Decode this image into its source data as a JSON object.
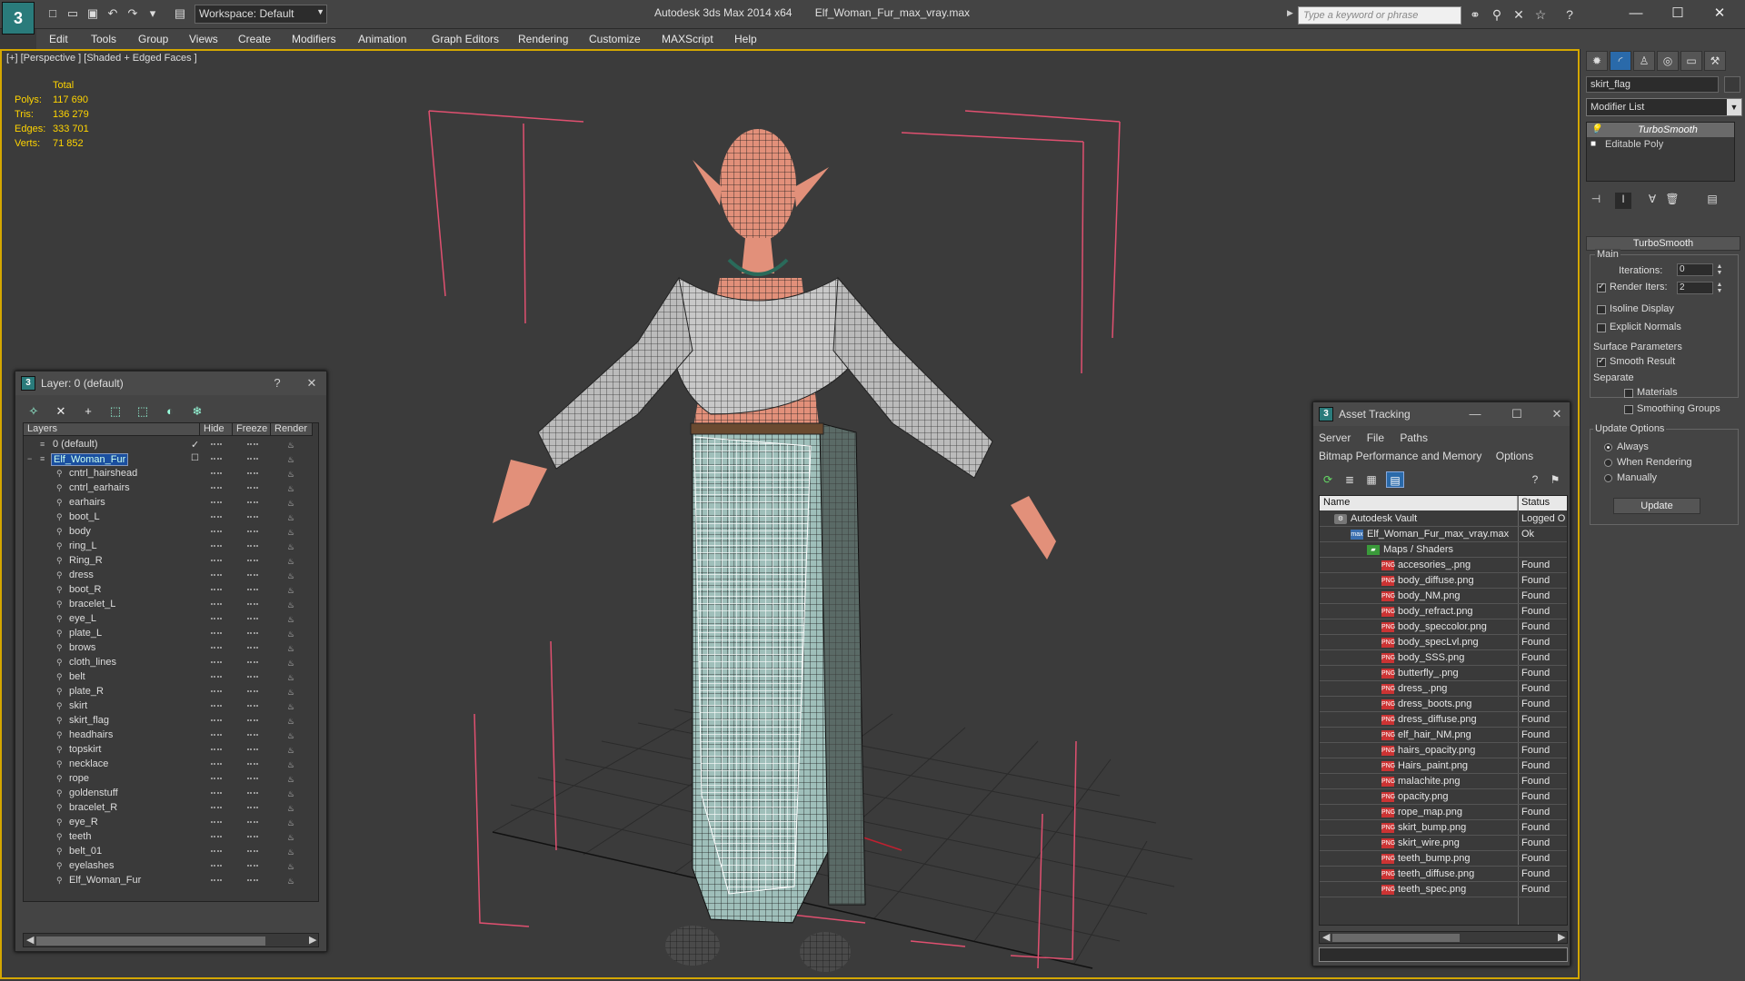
{
  "app": {
    "logo": "3",
    "workspace": "Workspace: Default",
    "title_app": "Autodesk 3ds Max  2014 x64",
    "title_file": "Elf_Woman_Fur_max_vray.max",
    "search_placeholder": "Type a keyword or phrase"
  },
  "menu": [
    "Edit",
    "Tools",
    "Group",
    "Views",
    "Create",
    "Modifiers",
    "Animation",
    "Graph Editors",
    "Rendering",
    "Customize",
    "MAXScript",
    "Help"
  ],
  "viewport": {
    "label": "[+] [Perspective ] [Shaded + Edged Faces ]",
    "stats": {
      "header": "Total",
      "polys_label": "Polys:",
      "polys": "117 690",
      "tris_label": "Tris:",
      "tris": "136 279",
      "edges_label": "Edges:",
      "edges": "333 701",
      "verts_label": "Verts:",
      "verts": "71 852"
    },
    "colors": {
      "border": "#d4a700",
      "stats": "#ffd400",
      "bbox": "#e05070",
      "grid": "#2c2c2c"
    }
  },
  "command_panel": {
    "object_name": "skirt_flag",
    "modifier_list": "Modifier List",
    "stack": [
      "TurboSmooth",
      "Editable Poly"
    ],
    "turbosmooth": {
      "title": "TurboSmooth",
      "main": "Main",
      "iterations_label": "Iterations:",
      "iterations": "0",
      "render_iters_label": "Render Iters:",
      "render_iters": "2",
      "isoline": "Isoline Display",
      "explicit": "Explicit Normals",
      "surface": "Surface Parameters",
      "smooth_result": "Smooth Result",
      "separate": "Separate",
      "materials": "Materials",
      "smoothing_groups": "Smoothing Groups",
      "update_options": "Update Options",
      "always": "Always",
      "when_rendering": "When Rendering",
      "manually": "Manually",
      "update": "Update"
    }
  },
  "layer_dialog": {
    "title": "Layer: 0 (default)",
    "help": "?",
    "close": "✕",
    "columns": {
      "layers": "Layers",
      "hide": "Hide",
      "freeze": "Freeze",
      "render": "Render"
    },
    "rows": [
      "0 (default)",
      "Elf_Woman_Fur",
      "cntrl_hairshead",
      "cntrl_earhairs",
      "earhairs",
      "boot_L",
      "body",
      "ring_L",
      "Ring_R",
      "dress",
      "boot_R",
      "bracelet_L",
      "eye_L",
      "plate_L",
      "brows",
      "cloth_lines",
      "belt",
      "plate_R",
      "skirt",
      "skirt_flag",
      "headhairs",
      "topskirt",
      "necklace",
      "rope",
      "goldenstuff",
      "bracelet_R",
      "eye_R",
      "teeth",
      "belt_01",
      "eyelashes",
      "Elf_Woman_Fur"
    ]
  },
  "asset_dialog": {
    "title": "Asset Tracking",
    "menu1": [
      "Server",
      "File",
      "Paths"
    ],
    "menu2": [
      "Bitmap Performance and Memory",
      "Options"
    ],
    "columns": {
      "name": "Name",
      "status": "Status"
    },
    "vault": {
      "name": "Autodesk Vault",
      "status": "Logged O"
    },
    "file": {
      "name": "Elf_Woman_Fur_max_vray.max",
      "status": "Ok"
    },
    "folder": {
      "name": "Maps / Shaders",
      "status": ""
    },
    "maps": [
      "accesories_.png",
      "body_diffuse.png",
      "body_NM.png",
      "body_refract.png",
      "body_speccolor.png",
      "body_specLvl.png",
      "body_SSS.png",
      "butterfly_.png",
      "dress_.png",
      "dress_boots.png",
      "dress_diffuse.png",
      "elf_hair_NM.png",
      "hairs_opacity.png",
      "Hairs_paint.png",
      "malachite.png",
      "opacity.png",
      "rope_map.png",
      "skirt_bump.png",
      "skirt_wire.png",
      "teeth_bump.png",
      "teeth_diffuse.png",
      "teeth_spec.png"
    ],
    "map_status": "Found"
  }
}
